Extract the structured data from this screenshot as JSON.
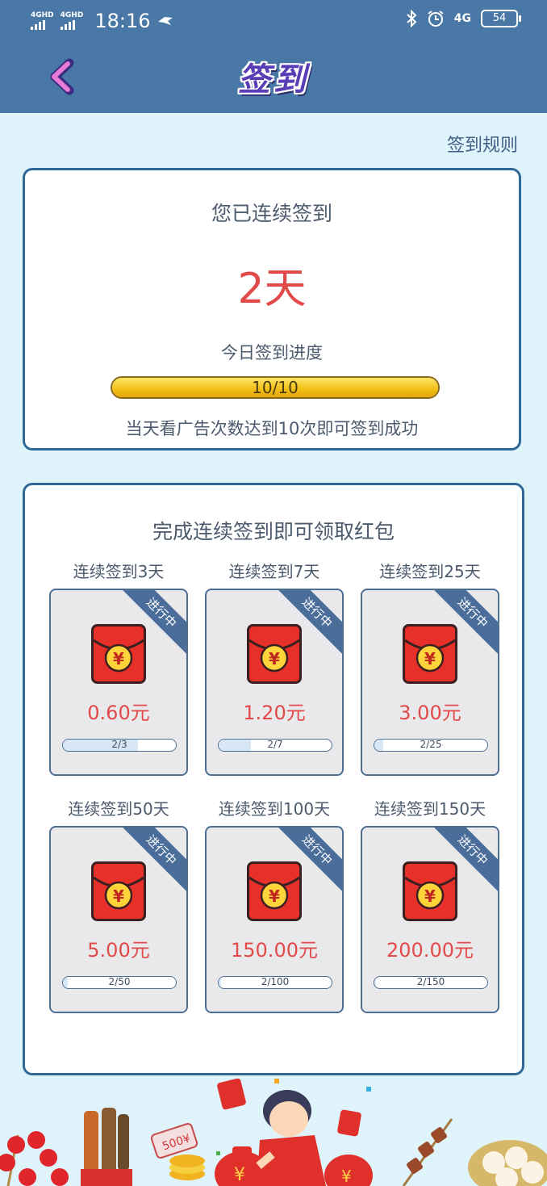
{
  "status_bar": {
    "signal1": "4GHD",
    "signal2": "4GHD",
    "time": "18:16",
    "network": "4G",
    "battery": "54"
  },
  "header": {
    "title": "签到",
    "back_icon": "chevron-left-icon"
  },
  "rules_link": "签到规则",
  "streak_card": {
    "label": "您已连续签到",
    "days": "2天",
    "today_label": "今日签到进度",
    "progress_text": "10/10",
    "progress_fraction": 1.0,
    "hint": "当天看广告次数达到10次即可签到成功"
  },
  "rewards_card": {
    "title": "完成连续签到即可领取红包",
    "items": [
      {
        "label": "连续签到3天",
        "status": "进行中",
        "amount": "0.60元",
        "progress": "2/3",
        "fraction": 0.667
      },
      {
        "label": "连续签到7天",
        "status": "进行中",
        "amount": "1.20元",
        "progress": "2/7",
        "fraction": 0.286
      },
      {
        "label": "连续签到25天",
        "status": "进行中",
        "amount": "3.00元",
        "progress": "2/25",
        "fraction": 0.08
      },
      {
        "label": "连续签到50天",
        "status": "进行中",
        "amount": "5.00元",
        "progress": "2/50",
        "fraction": 0.04
      },
      {
        "label": "连续签到100天",
        "status": "进行中",
        "amount": "150.00元",
        "progress": "2/100",
        "fraction": 0.02
      },
      {
        "label": "连续签到150天",
        "status": "进行中",
        "amount": "200.00元",
        "progress": "2/150",
        "fraction": 0.013
      }
    ]
  },
  "decoration": {
    "badge_text": "500¥",
    "currency": "¥"
  },
  "colors": {
    "header": "#4a78a6",
    "accent_red": "#e24a4a",
    "card_border": "#2f6898",
    "progress_gold": "#f2be14"
  }
}
